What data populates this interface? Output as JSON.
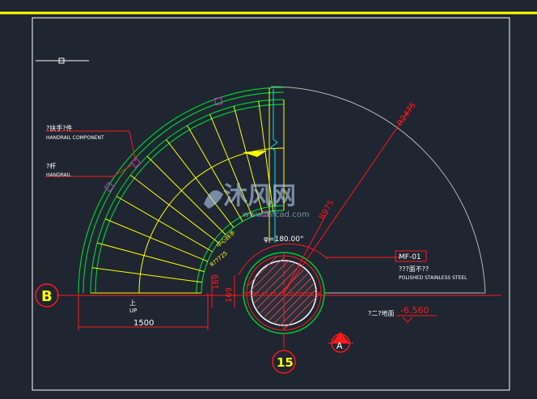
{
  "colors": {
    "background": "#1f2531",
    "frame": "#ffffff",
    "title_rule": "#ffff00",
    "handrail": "#00cc33",
    "treads": "#ffff00",
    "dimension": "#ff1a1a",
    "outline": "#b9b9b9",
    "cyan": "#00e5e5",
    "magenta": "#cc33cc",
    "watermark": "#bfe0ff"
  },
  "labels": {
    "handrail_component_cn": "?扶手?件",
    "handrail_component_en": "HANDRAIL COMPONENT",
    "handrail_cn": "?杆",
    "handrail_en": "HANDRAIL",
    "radius_outer": "R2475",
    "radius_inner": "R975",
    "angle": "φ=180.00°",
    "mf_tag": "MF-01",
    "mf_cn": "???面不??",
    "mf_en": "POLISHED STAINLESS STEEL",
    "elevation_cn": "?二?地面",
    "elevation_value": "-6.560",
    "up_cn": "上",
    "up_en": "UP",
    "dim_1500": "1500",
    "dim_169_a": "169",
    "dim_169_b": "169",
    "center_cn": "中心扶手",
    "center_r": "R??725",
    "axis_b": "B",
    "axis_15": "15",
    "section_mark": "A",
    "watermark_brand": "沐风网",
    "watermark_url": "www.mfcad.com"
  }
}
